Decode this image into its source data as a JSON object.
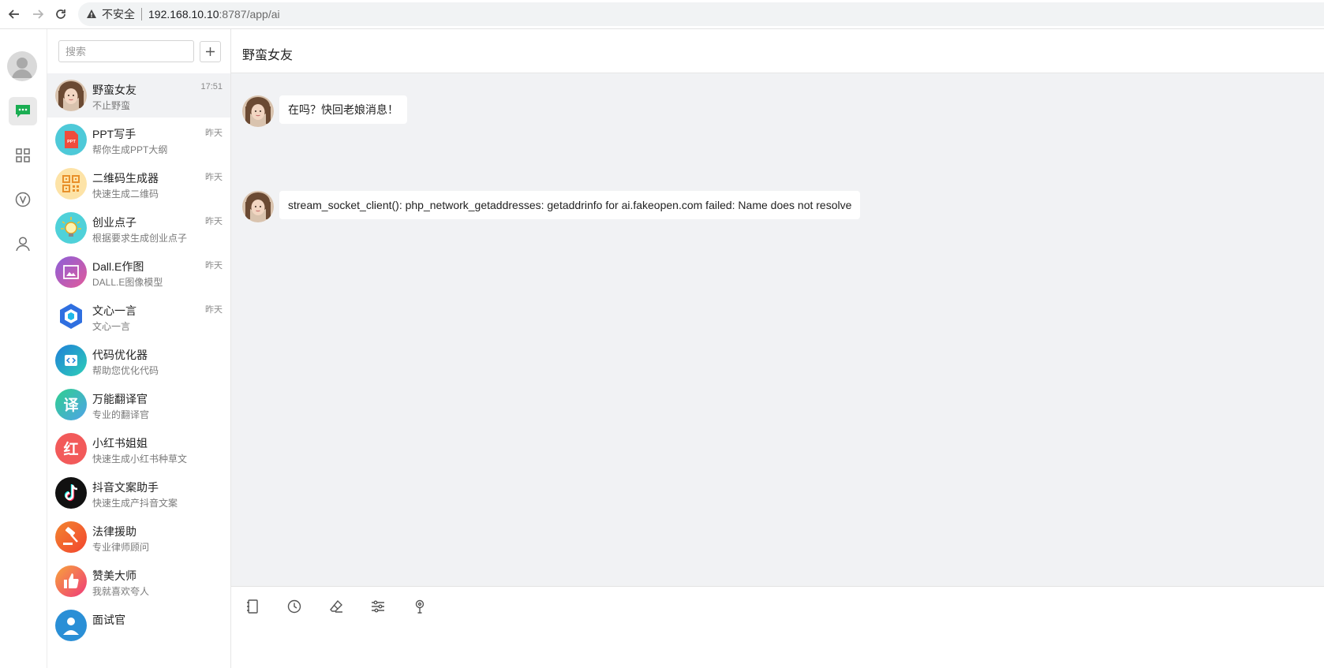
{
  "browser": {
    "insecure_label": "不安全",
    "url_host": "192.168.10.10",
    "url_path": ":8787/app/ai"
  },
  "rail": {
    "items": [
      "chat-icon",
      "apps-grid-icon",
      "vip-icon",
      "user-icon"
    ]
  },
  "sidebar": {
    "search_placeholder": "搜索",
    "add_label": "+",
    "conversations": [
      {
        "name": "野蛮女友",
        "subtitle": "不止野蛮",
        "time": "17:51",
        "icon": "girlfriend-avatar",
        "color": "#c9a48a"
      },
      {
        "name": "PPT写手",
        "subtitle": "帮你生成PPT大纲",
        "time": "昨天",
        "icon": "ppt-icon",
        "color": "#4ec9d8"
      },
      {
        "name": "二维码生成器",
        "subtitle": "快速生成二维码",
        "time": "昨天",
        "icon": "qrcode-icon",
        "color": "#fde3a7"
      },
      {
        "name": "创业点子",
        "subtitle": "根据要求生成创业点子",
        "time": "昨天",
        "icon": "lightbulb-icon",
        "color": "#4fd1d9"
      },
      {
        "name": "Dall.E作图",
        "subtitle": "DALL.E图像模型",
        "time": "昨天",
        "icon": "picture-icon",
        "color": "#b45fd1"
      },
      {
        "name": "文心一言",
        "subtitle": "文心一言",
        "time": "昨天",
        "icon": "wenxin-icon",
        "color": "#2f6fe0"
      },
      {
        "name": "代码优化器",
        "subtitle": "帮助您优化代码",
        "time": "",
        "icon": "code-icon",
        "color": "#2e9bd8"
      },
      {
        "name": "万能翻译官",
        "subtitle": "专业的翻译官",
        "time": "",
        "icon": "translate-icon",
        "color": "#3fc7a4"
      },
      {
        "name": "小红书姐姐",
        "subtitle": "快速生成小红书种草文",
        "time": "",
        "icon": "xiaohongshu-icon",
        "color": "#f25a5a"
      },
      {
        "name": "抖音文案助手",
        "subtitle": "快速生成产抖音文案",
        "time": "",
        "icon": "tiktok-icon",
        "color": "#111111"
      },
      {
        "name": "法律援助",
        "subtitle": "专业律师顾问",
        "time": "",
        "icon": "gavel-icon",
        "color": "#f26b2f"
      },
      {
        "name": "赞美大师",
        "subtitle": "我就喜欢夸人",
        "time": "",
        "icon": "thumbs-up-icon",
        "color": "#f0487a"
      },
      {
        "name": "面试官",
        "subtitle": "",
        "time": "",
        "icon": "interviewer-icon",
        "color": "#2a8fd6"
      }
    ],
    "translate_glyph": "译",
    "xiaohongshu_glyph": "红",
    "ppt_glyph": "PPT"
  },
  "chat": {
    "title": "野蛮女友",
    "messages": [
      {
        "text": "在吗？快回老娘消息！"
      },
      {
        "text": "stream_socket_client(): php_network_getaddresses: getaddrinfo for ai.fakeopen.com failed: Name does not resolve"
      }
    ]
  },
  "toolbar": {
    "tools": [
      "notebook-icon",
      "history-icon",
      "eraser-icon",
      "settings-sliders-icon",
      "pin-icon"
    ]
  }
}
